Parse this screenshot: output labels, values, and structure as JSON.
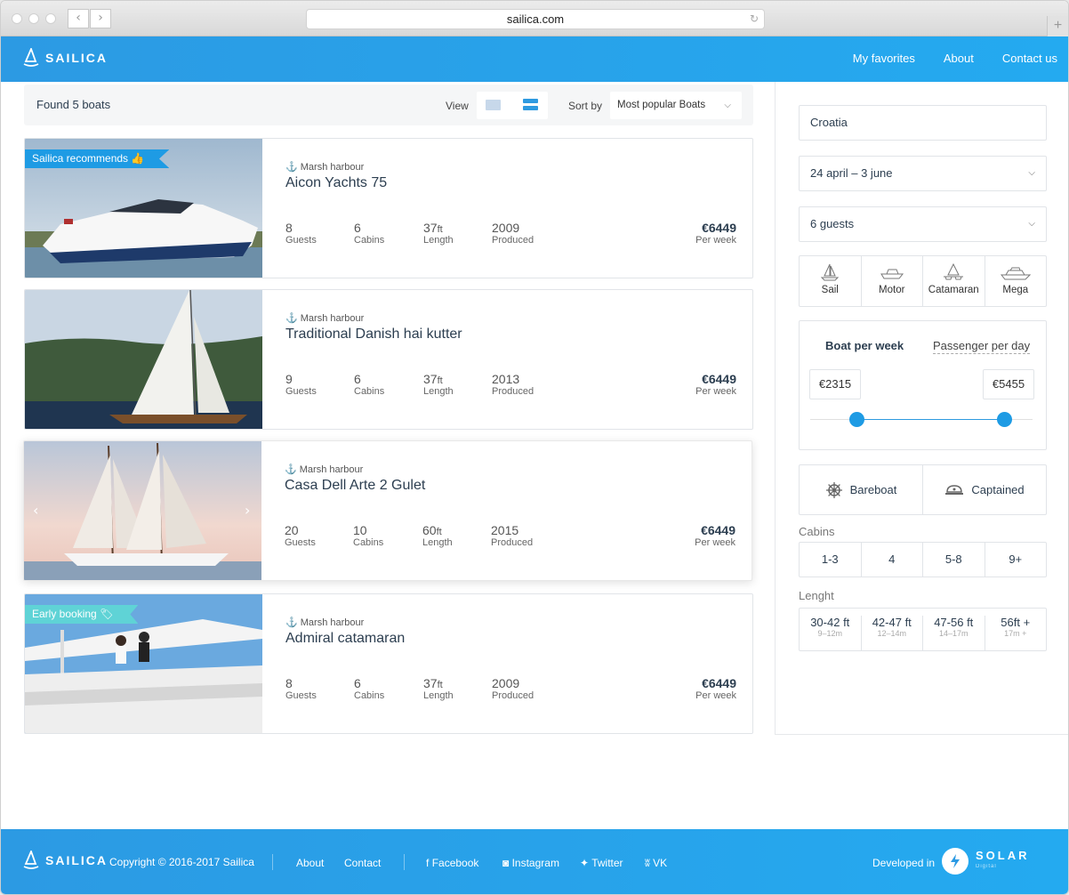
{
  "browser": {
    "url": "sailica.com"
  },
  "header": {
    "brand": "SAILICA",
    "nav": [
      "My favorites",
      "About",
      "Contact us"
    ]
  },
  "toolbar": {
    "found": "Found 5 boats",
    "view_label": "View",
    "sort_label": "Sort by",
    "sort_value": "Most popular Boats"
  },
  "boats": [
    {
      "badge": "Sailica recommends",
      "location": "Marsh harbour",
      "name": "Aicon Yachts 75",
      "guests": "8",
      "cabins": "6",
      "length": "37",
      "produced": "2009",
      "price": "€6449"
    },
    {
      "badge": "",
      "location": "Marsh harbour",
      "name": "Traditional Danish hai kutter",
      "guests": "9",
      "cabins": "6",
      "length": "37",
      "produced": "2013",
      "price": "€6449"
    },
    {
      "badge": "",
      "location": "Marsh harbour",
      "name": "Casa Dell Arte 2 Gulet",
      "guests": "20",
      "cabins": "10",
      "length": "60",
      "produced": "2015",
      "price": "€6449"
    },
    {
      "badge": "Early booking",
      "location": "Marsh harbour",
      "name": "Admiral catamaran",
      "guests": "8",
      "cabins": "6",
      "length": "37",
      "produced": "2009",
      "price": "€6449"
    }
  ],
  "labels": {
    "guests": "Guests",
    "cabins": "Cabins",
    "length": "Length",
    "produced": "Produced",
    "per_week": "Per week",
    "ft": "ft"
  },
  "filters": {
    "destination": "Croatia",
    "dates": "24 april – 3 june",
    "guests": "6 guests",
    "types": [
      "Sail",
      "Motor",
      "Catamaran",
      "Mega"
    ],
    "price_tabs": [
      "Boat per week",
      "Passenger per day"
    ],
    "price_min": "€2315",
    "price_max": "€5455",
    "price_range_fraction": [
      0.21,
      0.88
    ],
    "captain": [
      "Bareboat",
      "Captained"
    ],
    "cabins_label": "Cabins",
    "cabins": [
      "1-3",
      "4",
      "5-8",
      "9+"
    ],
    "length_label": "Lenght",
    "lengths": [
      {
        "ft": "30-42 ft",
        "m": "9–12m"
      },
      {
        "ft": "42-47 ft",
        "m": "12–14m"
      },
      {
        "ft": "47-56 ft",
        "m": "14–17m"
      },
      {
        "ft": "56ft +",
        "m": "17m +"
      }
    ]
  },
  "footer": {
    "brand": "SAILICA",
    "copyright": "Copyright © 2016-2017 Sailica",
    "links": [
      "About",
      "Contact"
    ],
    "social": [
      "Facebook",
      "Instagram",
      "Twitter",
      "VK"
    ],
    "developed": "Developed in",
    "studio": "SOLAR",
    "studio_sub": "Digital"
  },
  "colors": {
    "brand": "#2c9ae3",
    "accent": "#1e9be4",
    "teal": "#5fd3d6"
  }
}
